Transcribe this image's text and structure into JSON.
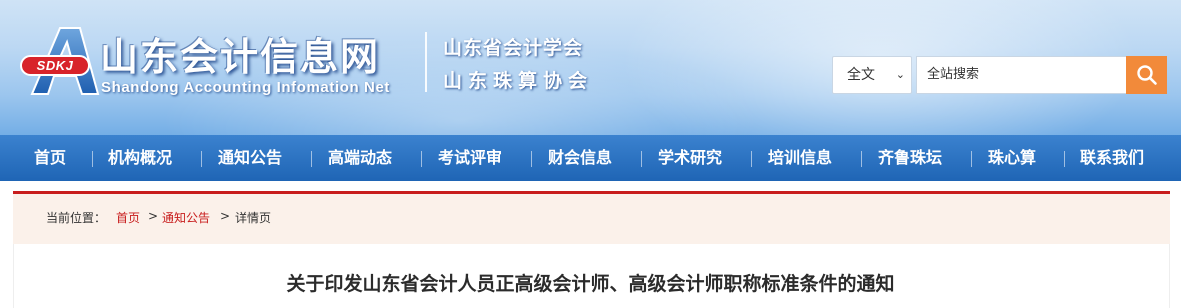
{
  "header": {
    "logo_badge": "SDKJ",
    "site_title": "山东会计信息网",
    "site_subtitle": "Shandong Accounting Infomation Net",
    "association_1": "山东省会计学会",
    "association_2": "山东珠算协会"
  },
  "search": {
    "scope_selected": "全文",
    "placeholder": "全站搜索",
    "button_icon": "search-icon",
    "button_color": "#f28a3a"
  },
  "nav": {
    "items": [
      {
        "label": "首页"
      },
      {
        "label": "机构概况"
      },
      {
        "label": "通知公告"
      },
      {
        "label": "高端动态"
      },
      {
        "label": "考试评审"
      },
      {
        "label": "财会信息"
      },
      {
        "label": "学术研究"
      },
      {
        "label": "培训信息"
      },
      {
        "label": "齐鲁珠坛"
      },
      {
        "label": "珠心算"
      },
      {
        "label": "联系我们"
      }
    ]
  },
  "breadcrumb": {
    "prefix": "当前位置：",
    "items": [
      "首页",
      "通知公告",
      "详情页"
    ],
    "separator": ">"
  },
  "article": {
    "title": "关于印发山东省会计人员正高级会计师、高级会计师职称标准条件的通知"
  },
  "colors": {
    "nav_blue": "#1f65b5",
    "accent_red": "#c81d1d",
    "crumb_bg": "#fbf1ea"
  }
}
